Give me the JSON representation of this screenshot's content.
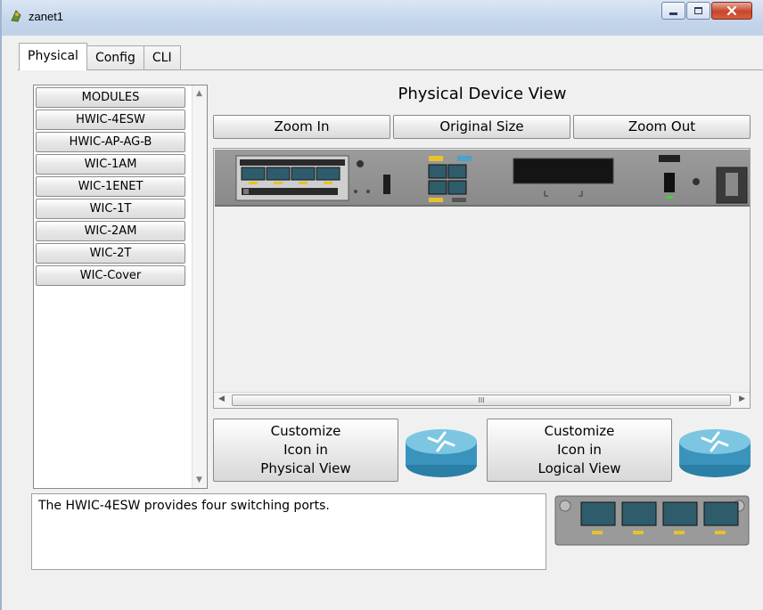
{
  "window": {
    "title": "zanet1",
    "minimize_label": "minimize",
    "maximize_label": "maximize",
    "close_label": "close"
  },
  "tabs": [
    {
      "label": "Physical",
      "active": true
    },
    {
      "label": "Config",
      "active": false
    },
    {
      "label": "CLI",
      "active": false
    }
  ],
  "modules": {
    "items": [
      "MODULES",
      "HWIC-4ESW",
      "HWIC-AP-AG-B",
      "WIC-1AM",
      "WIC-1ENET",
      "WIC-1T",
      "WIC-2AM",
      "WIC-2T",
      "WIC-Cover"
    ]
  },
  "physical_view": {
    "title": "Physical Device View",
    "zoom_in": "Zoom In",
    "original_size": "Original Size",
    "zoom_out": "Zoom Out",
    "scroll_grip": "III"
  },
  "customize": {
    "physical": [
      "Customize",
      "Icon in",
      "Physical View"
    ],
    "logical": [
      "Customize",
      "Icon in",
      "Logical View"
    ]
  },
  "description": "The HWIC-4ESW provides four switching ports.",
  "colors": {
    "accent_green": "#3dd33d",
    "port_yellow": "#e8c22a",
    "router_blue": "#4aa3c8"
  }
}
